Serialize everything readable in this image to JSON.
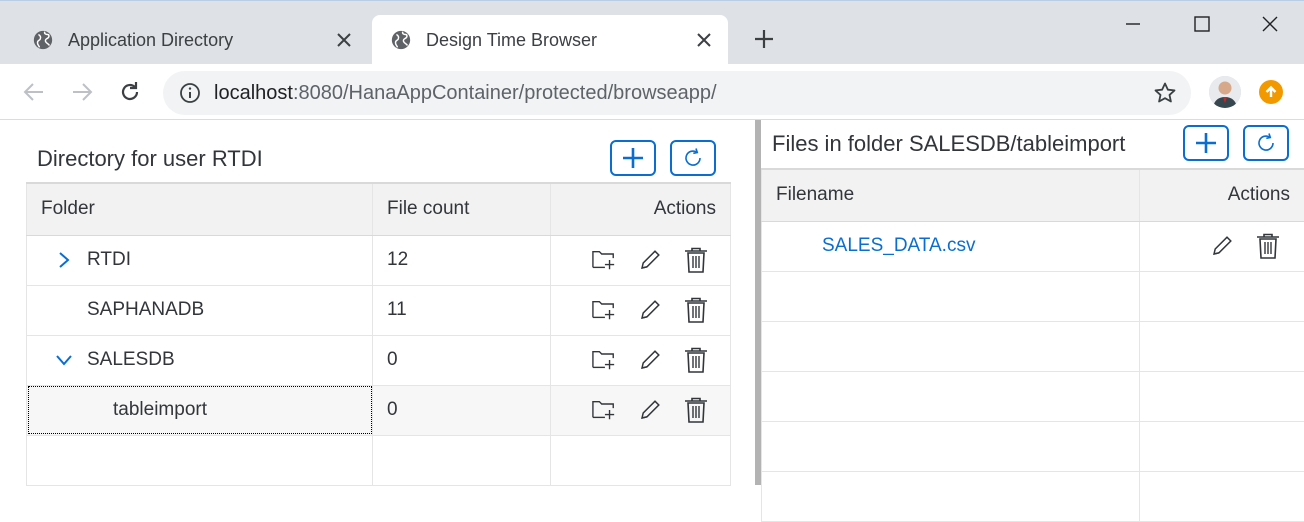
{
  "browser": {
    "tabs": [
      {
        "label": "Application Directory",
        "active": false,
        "icon": "globe-icon"
      },
      {
        "label": "Design Time Browser",
        "active": true,
        "icon": "globe-icon"
      }
    ],
    "url_host": "localhost",
    "url_rest": ":8080/HanaAppContainer/protected/browseapp/"
  },
  "left": {
    "title": "Directory for user RTDI",
    "columns": {
      "folder": "Folder",
      "file_count": "File count",
      "actions": "Actions"
    },
    "rows": [
      {
        "name": "RTDI",
        "count": "12",
        "expander": "chevron-right"
      },
      {
        "name": "SAPHANADB",
        "count": "11",
        "expander": "none"
      },
      {
        "name": "SALESDB",
        "count": "0",
        "expander": "chevron-down"
      },
      {
        "name": "tableimport",
        "count": "0",
        "expander": "child"
      }
    ]
  },
  "right": {
    "title": "Files in folder SALESDB/tableimport",
    "columns": {
      "filename": "Filename",
      "actions": "Actions"
    },
    "rows": [
      {
        "name": "SALES_DATA.csv"
      }
    ]
  },
  "colors": {
    "accent": "#0a6ed1",
    "text": "#32363a",
    "header_bg": "#f2f2f2"
  }
}
